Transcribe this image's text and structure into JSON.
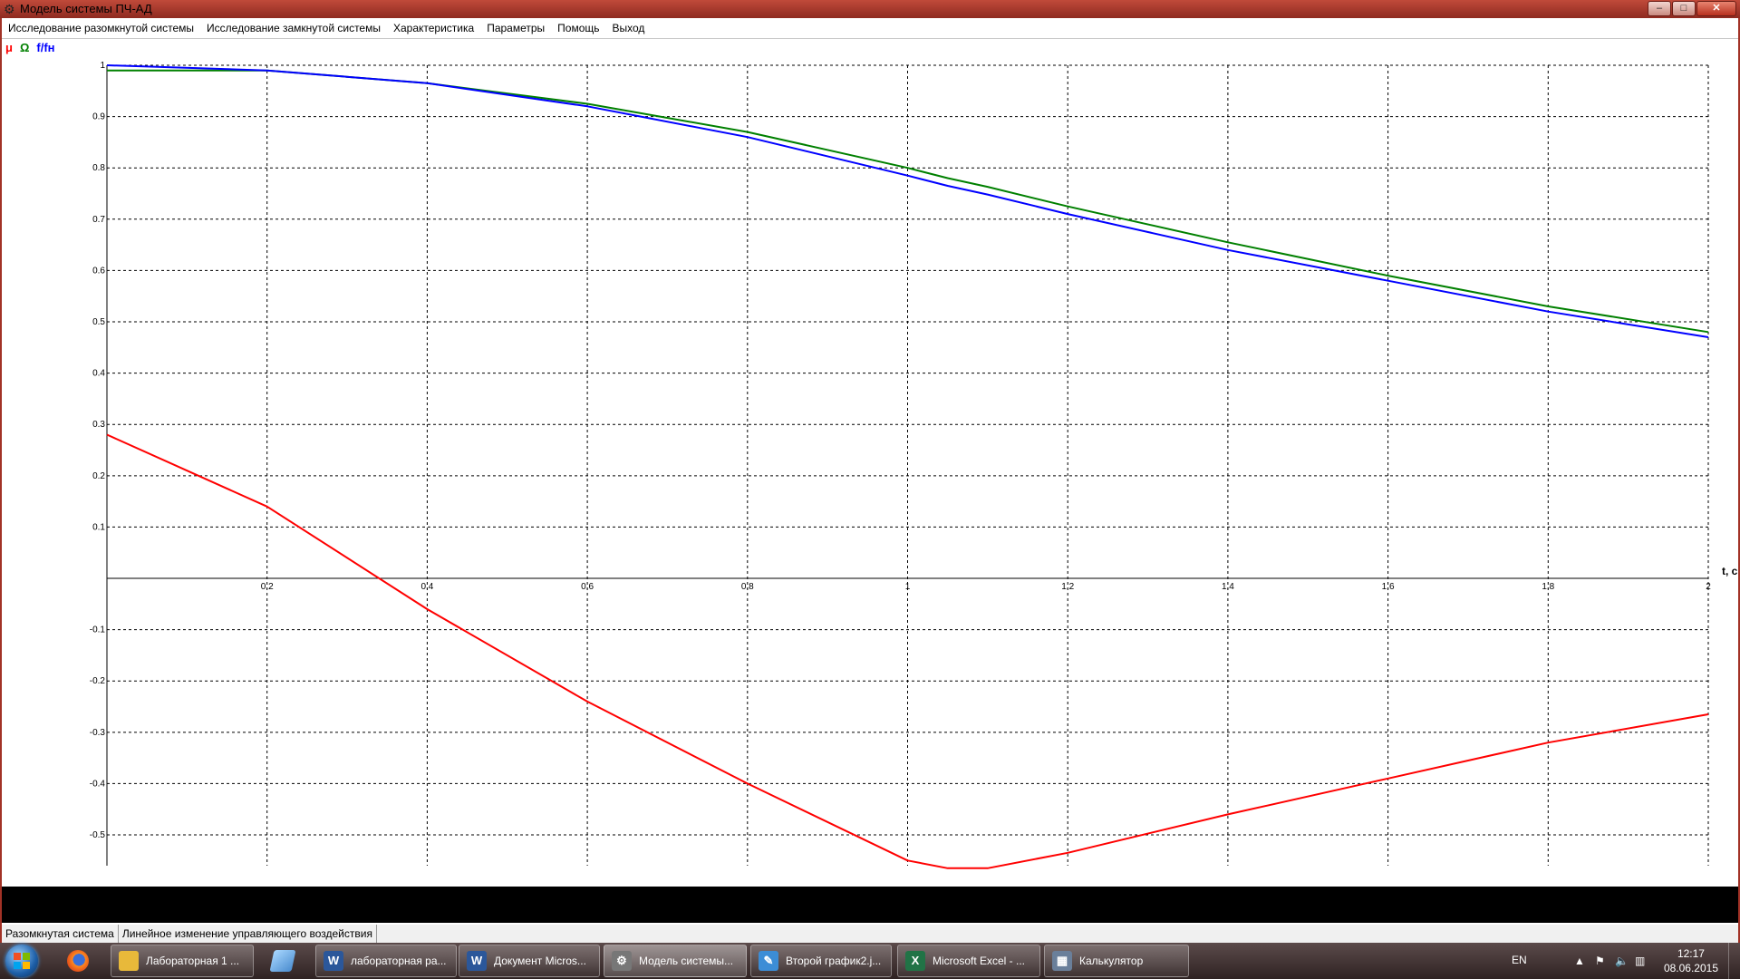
{
  "window": {
    "title": "Модель системы ПЧ-АД",
    "minimize": "‒",
    "maximize": "□",
    "close": "✕"
  },
  "menu": [
    "Исследование разомкнутой системы",
    "Исследование замкнутой системы",
    "Характеристика",
    "Параметры",
    "Помощь",
    "Выход"
  ],
  "legend": [
    {
      "label": "μ",
      "color": "#ff0000"
    },
    {
      "label": "Ω",
      "color": "#008000"
    },
    {
      "label": "f/fн",
      "color": "#0000ff"
    }
  ],
  "chart_data": {
    "type": "line",
    "xlabel": "t, c",
    "ylabel": "",
    "xlim": [
      0,
      2
    ],
    "ylim": [
      -0.56,
      1
    ],
    "grid": true,
    "x_ticks": [
      "0.2",
      "0.4",
      "0.6",
      "0.8",
      "1",
      "1.2",
      "1.4",
      "1.6",
      "1.8",
      "2"
    ],
    "y_ticks": [
      "1",
      "0.9",
      "0.8",
      "0.7",
      "0.6",
      "0.5",
      "0.4",
      "0.3",
      "0.2",
      "0.1",
      "-0.1",
      "-0.2",
      "-0.3",
      "-0.4",
      "-0.5"
    ],
    "x": [
      0,
      0.2,
      0.4,
      0.6,
      0.8,
      1.0,
      1.05,
      1.1,
      1.2,
      1.4,
      1.6,
      1.8,
      2.0
    ],
    "series": [
      {
        "name": "μ",
        "color": "#ff0000",
        "values": [
          0.28,
          0.14,
          -0.06,
          -0.24,
          -0.4,
          -0.55,
          -0.565,
          -0.565,
          -0.535,
          -0.46,
          -0.39,
          -0.32,
          -0.265
        ]
      },
      {
        "name": "Ω",
        "color": "#008000",
        "values": [
          0.99,
          0.99,
          0.965,
          0.925,
          0.87,
          0.8,
          0.78,
          0.763,
          0.725,
          0.655,
          0.59,
          0.53,
          0.48
        ]
      },
      {
        "name": "f/fн",
        "color": "#0000ff",
        "values": [
          1.0,
          0.99,
          0.965,
          0.92,
          0.86,
          0.785,
          0.765,
          0.748,
          0.71,
          0.64,
          0.58,
          0.52,
          0.47
        ]
      }
    ]
  },
  "status": {
    "mode": "Разомкнутая система",
    "description": "Линейное изменение управляющего воздействия"
  },
  "taskbar": {
    "buttons": [
      {
        "label": "Лабораторная 1 ...",
        "icon": "folder-icon",
        "color": "#e8b93a"
      },
      {
        "label": "лабораторная ра...",
        "icon": "word-icon",
        "color": "#2b579a"
      },
      {
        "label": "Документ Micros...",
        "icon": "word-icon",
        "color": "#2b579a"
      },
      {
        "label": "Модель системы...",
        "icon": "gear-icon",
        "color": "#777777"
      },
      {
        "label": "Второй график2.j...",
        "icon": "paint-icon",
        "color": "#3c8dd6"
      },
      {
        "label": "Microsoft Excel - ...",
        "icon": "excel-icon",
        "color": "#217346"
      },
      {
        "label": "Калькулятор",
        "icon": "calculator-icon",
        "color": "#6a7f9a"
      }
    ],
    "lang": "EN",
    "time": "12:17",
    "date": "08.06.2015"
  }
}
